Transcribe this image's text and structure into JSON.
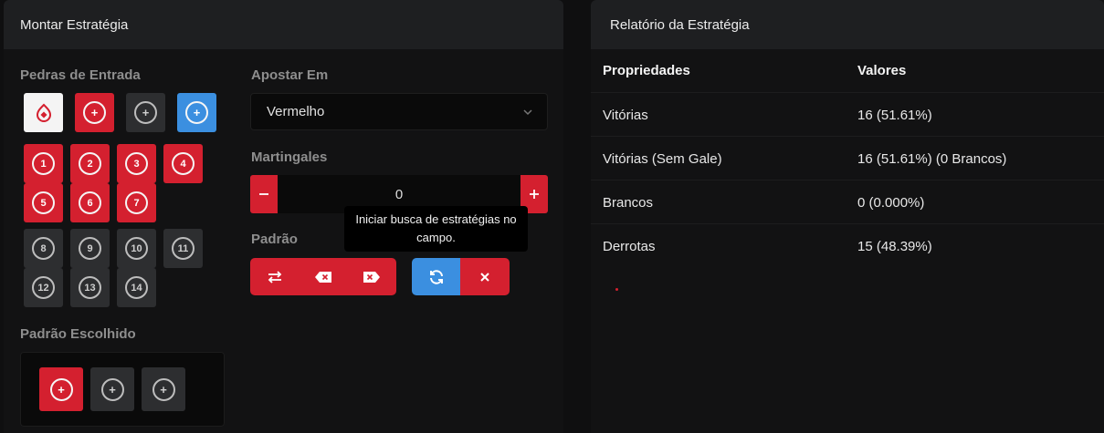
{
  "left_panel": {
    "title": "Montar Estratégia",
    "entry_stones_label": "Pedras de Entrada",
    "numbers_red": [
      "1",
      "2",
      "3",
      "4",
      "5",
      "6",
      "7"
    ],
    "numbers_dark": [
      "8",
      "9",
      "10",
      "11",
      "12",
      "13",
      "14"
    ],
    "bet_on_label": "Apostar Em",
    "bet_on_value": "Vermelho",
    "martingales_label": "Martingales",
    "martingales_value": "0",
    "pattern_label": "Padrão",
    "tooltip": "Iniciar busca de estratégias no campo.",
    "chosen_pattern_label": "Padrão Escolhido"
  },
  "right_panel": {
    "title": "Relatório da Estratégia",
    "headers": [
      "Propriedades",
      "Valores"
    ],
    "rows": [
      {
        "prop": "Vitórias",
        "value": "16 (51.61%)"
      },
      {
        "prop": "Vitórias (Sem Gale)",
        "value": "16 (51.61%) (0 Brancos)"
      },
      {
        "prop": "Brancos",
        "value": "0 (0.000%)"
      },
      {
        "prop": "Derrotas",
        "value": "15 (48.39%)"
      }
    ]
  },
  "colors": {
    "red": "#d4202f",
    "dark": "#2d2e30",
    "blue": "#3b8fe0",
    "white": "#f4f4f4"
  },
  "icons": [
    "blaze-logo-icon",
    "plus-icon",
    "swap-icon",
    "backspace-icon",
    "delete-right-icon",
    "refresh-icon",
    "close-icon",
    "chevron-down-icon"
  ]
}
